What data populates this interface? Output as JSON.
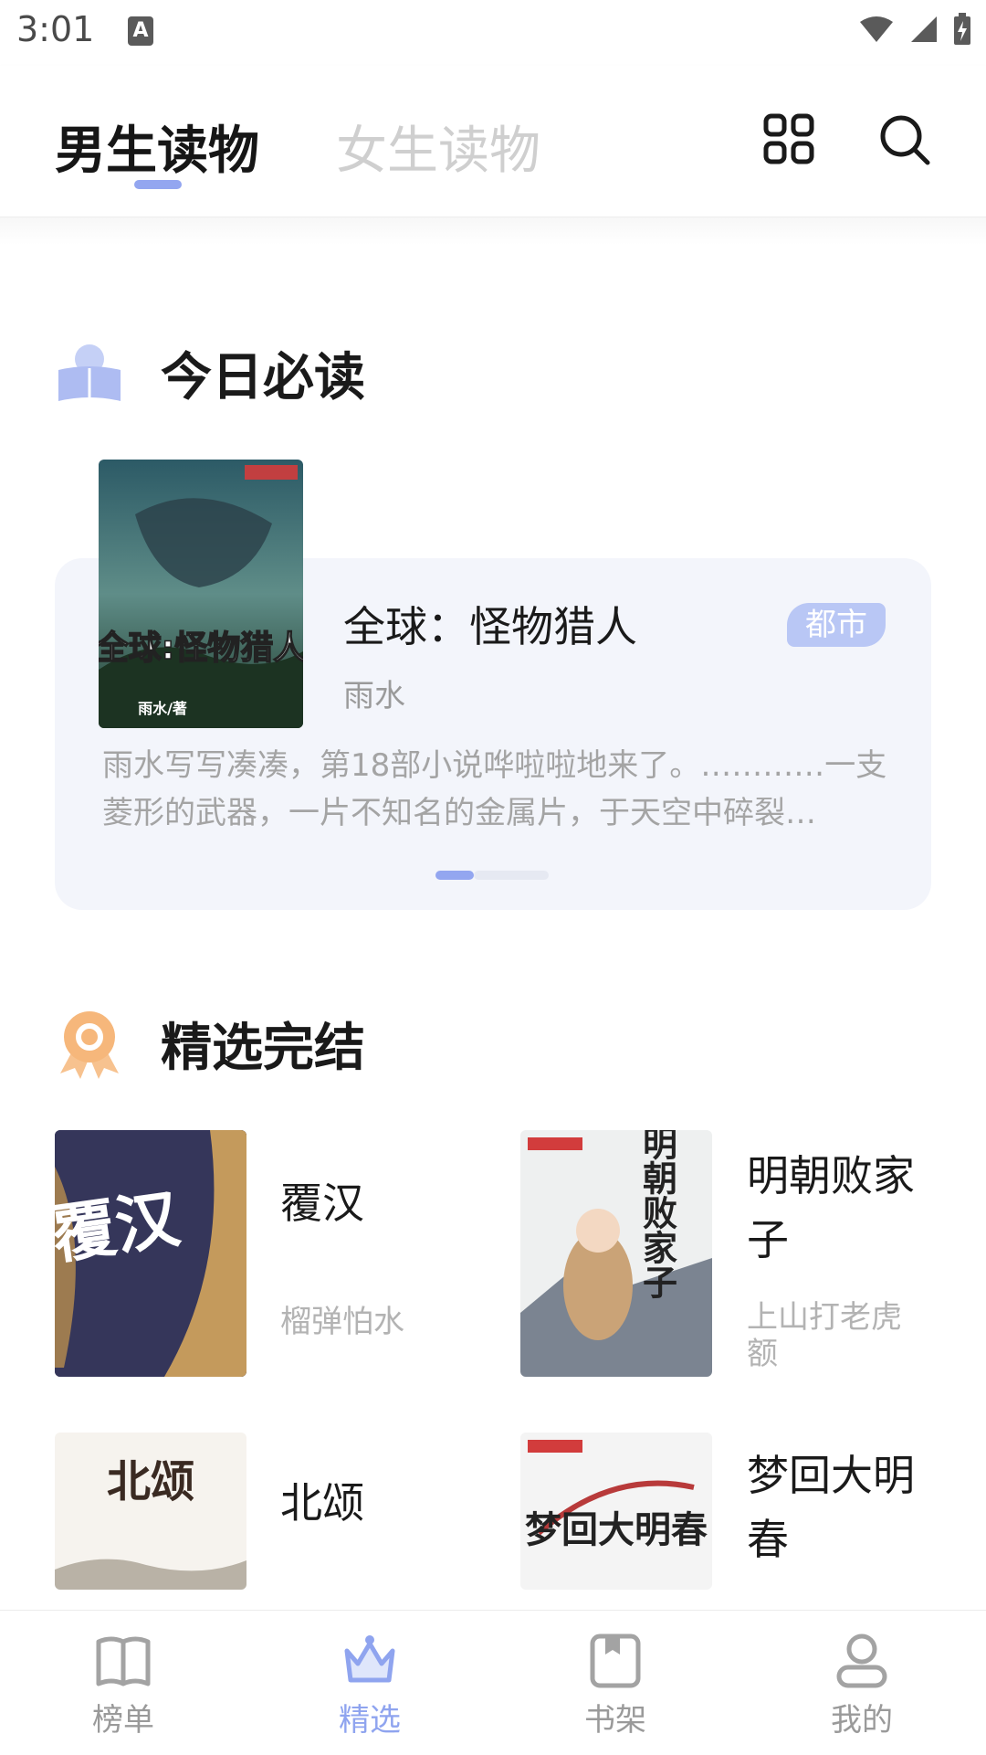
{
  "status": {
    "time": "3:01",
    "a_glyph": "A"
  },
  "header": {
    "tabs": [
      {
        "label": "男生读物"
      },
      {
        "label": "女生读物"
      }
    ]
  },
  "today": {
    "section_title": "今日必读",
    "book": {
      "title": "全球：怪物猎人",
      "genre": "都市",
      "author": "雨水",
      "description": "雨水写写凑凑，第18部小说哗啦啦地来了。…………一支菱形的武器，一片不知名的金属片，于天空中碎裂…",
      "cover_text": "全球:怪物猎人",
      "cover_author": "雨水/著"
    },
    "carousel_index": 1
  },
  "completed": {
    "section_title": "精选完结",
    "books": [
      {
        "title": "覆汉",
        "author": "榴弹怕水",
        "cover_text": "覆汉"
      },
      {
        "title": "明朝败家子",
        "author": "上山打老虎额",
        "cover_text": "明朝败家子"
      },
      {
        "title": "北颂",
        "author": "",
        "cover_text": "北颂"
      },
      {
        "title": "梦回大明春",
        "author": "",
        "cover_text": "梦回大明春"
      }
    ]
  },
  "bottom_nav": [
    {
      "label": "榜单",
      "icon": "open-book-icon",
      "active": false
    },
    {
      "label": "精选",
      "icon": "crown-icon",
      "active": true
    },
    {
      "label": "书架",
      "icon": "bookshelf-icon",
      "active": false
    },
    {
      "label": "我的",
      "icon": "profile-icon",
      "active": false
    }
  ],
  "colors": {
    "accent": "#93a6f0",
    "card_bg": "#f3f5fb",
    "badge": "#b9c7f5"
  }
}
